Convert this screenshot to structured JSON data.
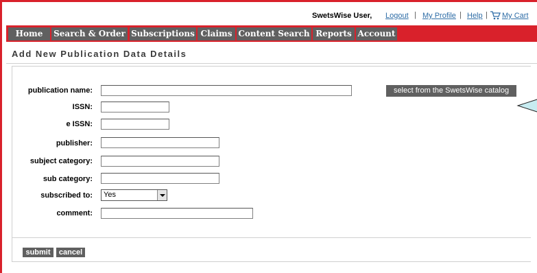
{
  "header": {
    "user_name": "SwetsWise User,",
    "links": {
      "logout": "Logout",
      "my_profile": "My Profile",
      "help": "Help",
      "my_cart": "My Cart"
    },
    "separators": [
      "|",
      "|",
      "|"
    ],
    "cart_icon": "cart-icon"
  },
  "nav": {
    "tabs": [
      "Home",
      "Search & Order",
      "Subscriptions",
      "Claims",
      "Content Search",
      "Reports",
      "Account"
    ]
  },
  "page": {
    "title": "Add New Publication Data Details"
  },
  "form": {
    "fields": {
      "publication_name": {
        "label": "publication name:",
        "value": ""
      },
      "issn": {
        "label": "ISSN:",
        "value": ""
      },
      "eissn": {
        "label": "e ISSN:",
        "value": ""
      },
      "publisher": {
        "label": "publisher:",
        "value": ""
      },
      "subject_category": {
        "label": "subject category:",
        "value": ""
      },
      "sub_category": {
        "label": "sub category:",
        "value": ""
      },
      "subscribed_to": {
        "label": "subscribed to:",
        "value": "Yes"
      },
      "comment": {
        "label": "comment:",
        "value": ""
      }
    },
    "catalog_button": "select from the SwetsWise catalog",
    "submit_label": "submit",
    "cancel_label": "cancel"
  },
  "colors": {
    "brand_red": "#d9212b",
    "tab_gray": "#606060",
    "link_blue": "#2d6ca6",
    "callout_fill": "#c7ecf1"
  }
}
